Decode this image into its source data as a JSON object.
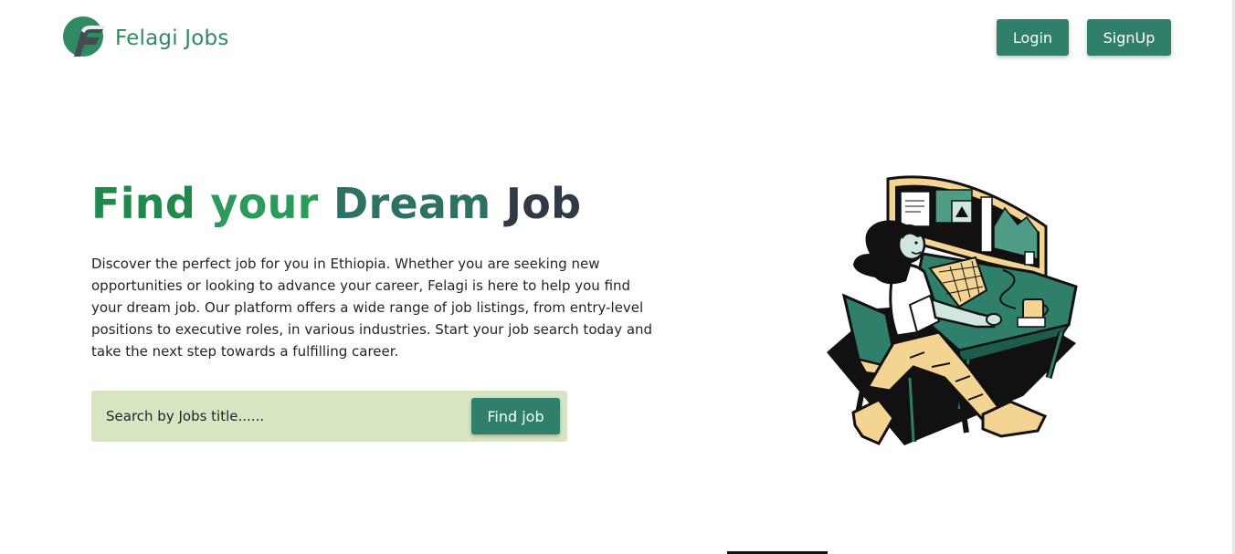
{
  "brand": {
    "name": "Felagi Jobs",
    "logo_icon": "felagi-f-logo"
  },
  "header": {
    "login_label": "Login",
    "signup_label": "SignUp"
  },
  "hero": {
    "title_words": [
      "Find",
      "your",
      "Dream",
      "Job"
    ],
    "description": "Discover the perfect job for you in Ethiopia. Whether you are seeking new opportunities or looking to advance your career, Felagi is here to help you find your dream job. Our platform offers a wide range of job listings, from entry-level positions to executive roles, in various industries. Start your job search today and take the next step towards a fulfilling career."
  },
  "search": {
    "placeholder": "Search by Jobs title......",
    "value": "",
    "button_label": "Find job"
  },
  "colors": {
    "primary": "#2f7f6a",
    "brand_green": "#2f8a62",
    "search_bg": "#d7e6c2",
    "title_dark": "#2f3a46"
  }
}
